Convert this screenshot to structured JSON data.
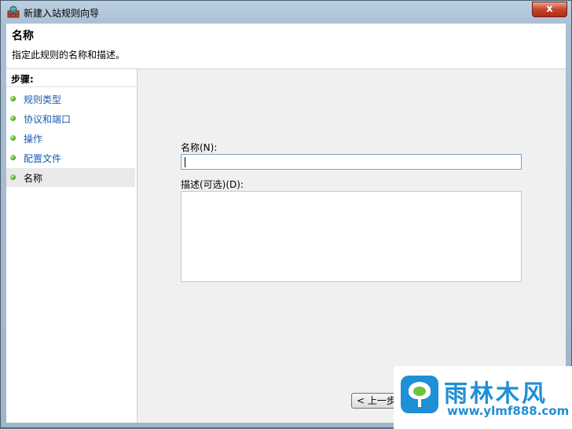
{
  "window": {
    "title": "新建入站规则向导",
    "close_label": "x"
  },
  "header": {
    "title": "名称",
    "subtitle": "指定此规则的名称和描述。"
  },
  "steps": {
    "title": "步骤:",
    "items": [
      {
        "label": "规则类型",
        "selected": false
      },
      {
        "label": "协议和端口",
        "selected": false
      },
      {
        "label": "操作",
        "selected": false
      },
      {
        "label": "配置文件",
        "selected": false
      },
      {
        "label": "名称",
        "selected": true
      }
    ]
  },
  "form": {
    "name_label": "名称(N):",
    "name_value": "",
    "description_label": "描述(可选)(D):",
    "description_value": ""
  },
  "buttons": {
    "prev_label": "< 上一步"
  },
  "watermark": {
    "title": "雨林木风",
    "url": "www.ylmf888.com",
    "color": "#1f8fd6"
  }
}
